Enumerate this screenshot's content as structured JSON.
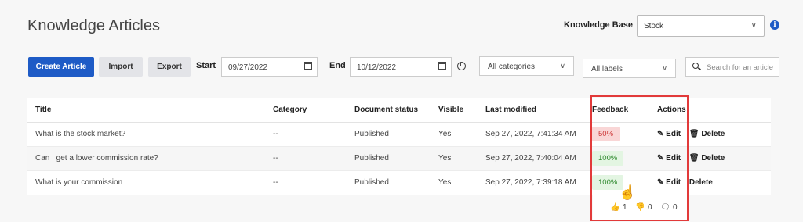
{
  "page": {
    "title": "Knowledge Articles"
  },
  "knowledge_base": {
    "label": "Knowledge Base",
    "value": "Stock"
  },
  "toolbar": {
    "create_label": "Create Article",
    "import_label": "Import",
    "export_label": "Export",
    "start_label": "Start",
    "start_date": "09/27/2022",
    "end_label": "End",
    "end_date": "10/12/2022",
    "categories_value": "All categories",
    "labels_value": "All labels",
    "search_placeholder": "Search for an article"
  },
  "table": {
    "headers": {
      "title": "Title",
      "category": "Category",
      "status": "Document status",
      "visible": "Visible",
      "modified": "Last modified",
      "feedback": "Feedback",
      "actions": "Actions"
    },
    "rows": [
      {
        "title": "What is the stock market?",
        "category": "--",
        "status": "Published",
        "visible": "Yes",
        "modified": "Sep 27, 2022, 7:41:34 AM",
        "feedback": "50%",
        "edit": "Edit",
        "delete": "Delete"
      },
      {
        "title": "Can I get a lower commission rate?",
        "category": "--",
        "status": "Published",
        "visible": "Yes",
        "modified": "Sep 27, 2022, 7:40:04 AM",
        "feedback": "100%",
        "edit": "Edit",
        "delete": "Delete"
      },
      {
        "title": "What is your commission",
        "category": "--",
        "status": "Published",
        "visible": "Yes",
        "modified": "Sep 27, 2022, 7:39:18 AM",
        "feedback": "100%",
        "edit": "Edit",
        "delete": "Delete"
      }
    ]
  },
  "feedback_popup": {
    "upvotes": "1",
    "downvotes": "0",
    "comments": "0"
  },
  "colors": {
    "primary": "#1e5bc6",
    "highlight": "#e23a3a",
    "positive": "#2f8a2f",
    "negative": "#cc3333"
  }
}
